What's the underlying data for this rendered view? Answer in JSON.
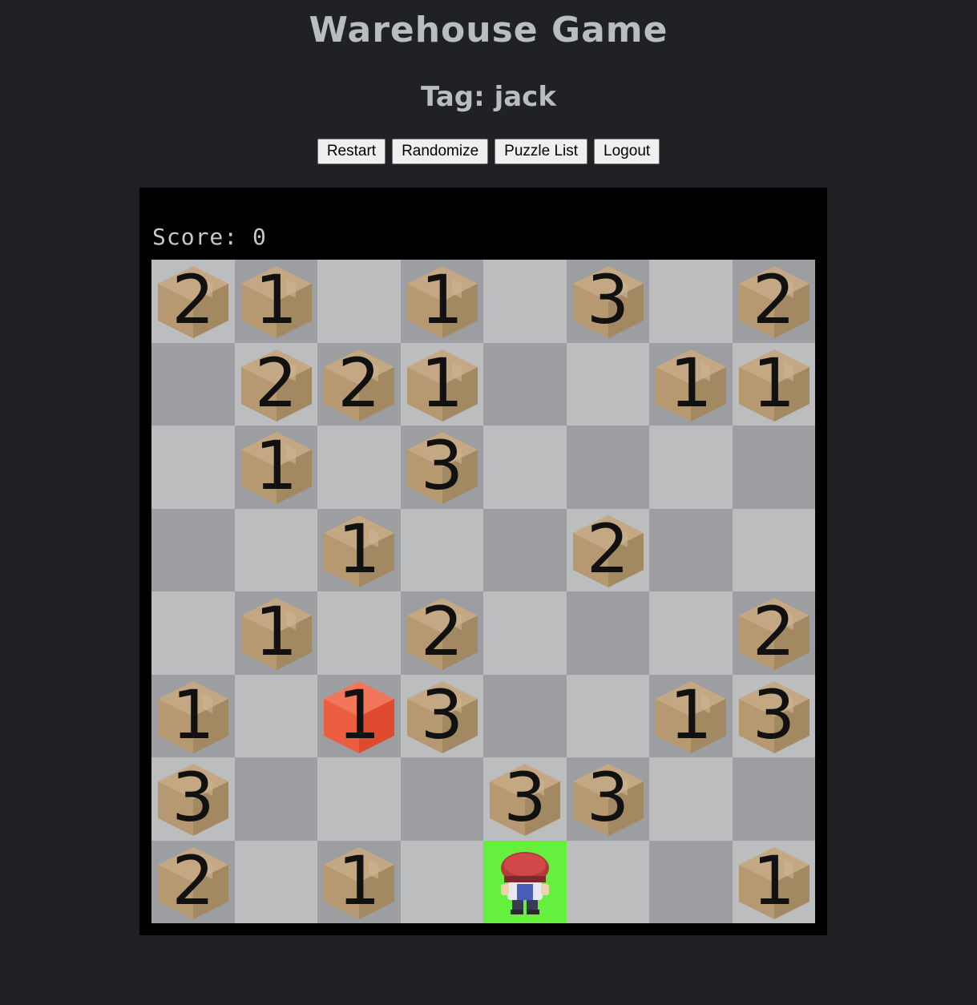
{
  "page": {
    "title": "Warehouse Game",
    "tag_line": "Tag: jack"
  },
  "toolbar": {
    "restart_label": "Restart",
    "randomize_label": "Randomize",
    "puzzle_list_label": "Puzzle List",
    "logout_label": "Logout"
  },
  "game": {
    "score_text": "Score: 0",
    "rows": 8,
    "cols": 8,
    "board": [
      [
        "2",
        "1",
        "",
        "1",
        "",
        "3",
        "",
        "2"
      ],
      [
        "",
        "2",
        "2",
        "1",
        "",
        "",
        "1",
        "1"
      ],
      [
        "",
        "1",
        "",
        "3",
        "",
        "",
        "",
        ""
      ],
      [
        "",
        "",
        "1",
        "",
        "",
        "2",
        "",
        ""
      ],
      [
        "",
        "1",
        "",
        "2",
        "",
        "",
        "",
        "2"
      ],
      [
        "1",
        "",
        "1r",
        "3",
        "",
        "",
        "1",
        "3"
      ],
      [
        "3",
        "",
        "",
        "",
        "3",
        "3",
        "",
        ""
      ],
      [
        "2",
        "",
        "1",
        "",
        "P",
        "",
        "",
        "1"
      ]
    ],
    "legend_codes": {
      "P": "player",
      "r": "highlighted-box"
    },
    "colors": {
      "light_tile": "#bcbdbf",
      "dark_tile": "#9d9ea1",
      "player_tile": "#64f03c",
      "box_top": "#c3a883",
      "box_left": "#b69970",
      "box_right": "#a38962",
      "red_top": "#f2775a",
      "red_left": "#ec5e40",
      "red_right": "#e04b2f"
    }
  }
}
